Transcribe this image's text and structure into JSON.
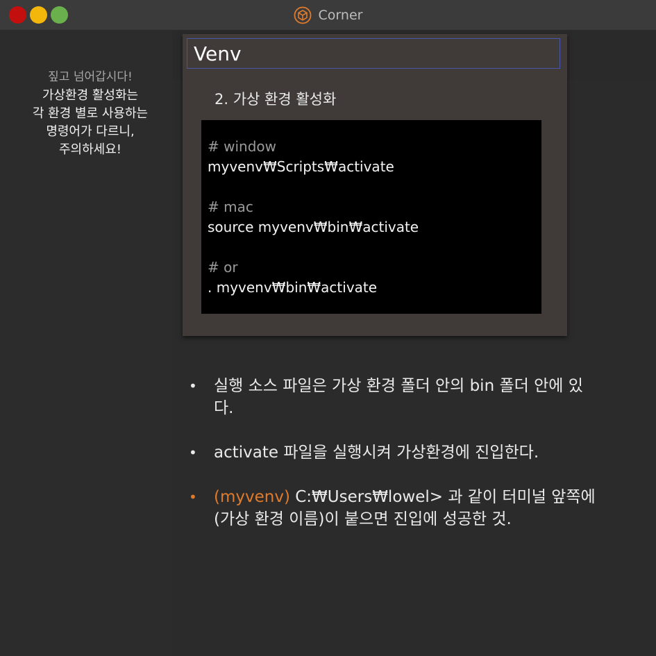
{
  "window": {
    "title": "Corner",
    "icon": "box-icon"
  },
  "colors": {
    "close": "#c40f0f",
    "minimize": "#f3b70c",
    "maximize": "#6ab04c",
    "accent_orange": "#e07b2c",
    "title_border": "#4a57a8"
  },
  "sidebar": {
    "heading": "짚고 넘어갑시다!",
    "lines": [
      "가상환경 활성화는",
      "각 환경 별로 사용하는",
      "명령어가 다르니,",
      "주의하세요!"
    ]
  },
  "card": {
    "title": "Venv",
    "subtitle": "2. 가상 환경 활성화",
    "code": {
      "windows_comment": "# window",
      "windows_cmd": "myvenv₩Scripts₩activate",
      "mac_comment": "# mac",
      "mac_cmd": "source myvenv₩bin₩activate",
      "or_comment": "# or",
      "or_cmd": ". myvenv₩bin₩activate"
    }
  },
  "notes": {
    "bullet": "•",
    "item1": "실행 소스 파일은 가상 환경 폴더 안의 bin 폴더 안에 있다.",
    "item2": "activate 파일을 실행시켜 가상환경에 진입한다.",
    "item3_highlight": "(myvenv)",
    "item3_rest": " C:₩Users₩lowel> 과 같이 터미널 앞쪽에 (가상 환경 이름)이 붙으면 진입에 성공한 것."
  }
}
